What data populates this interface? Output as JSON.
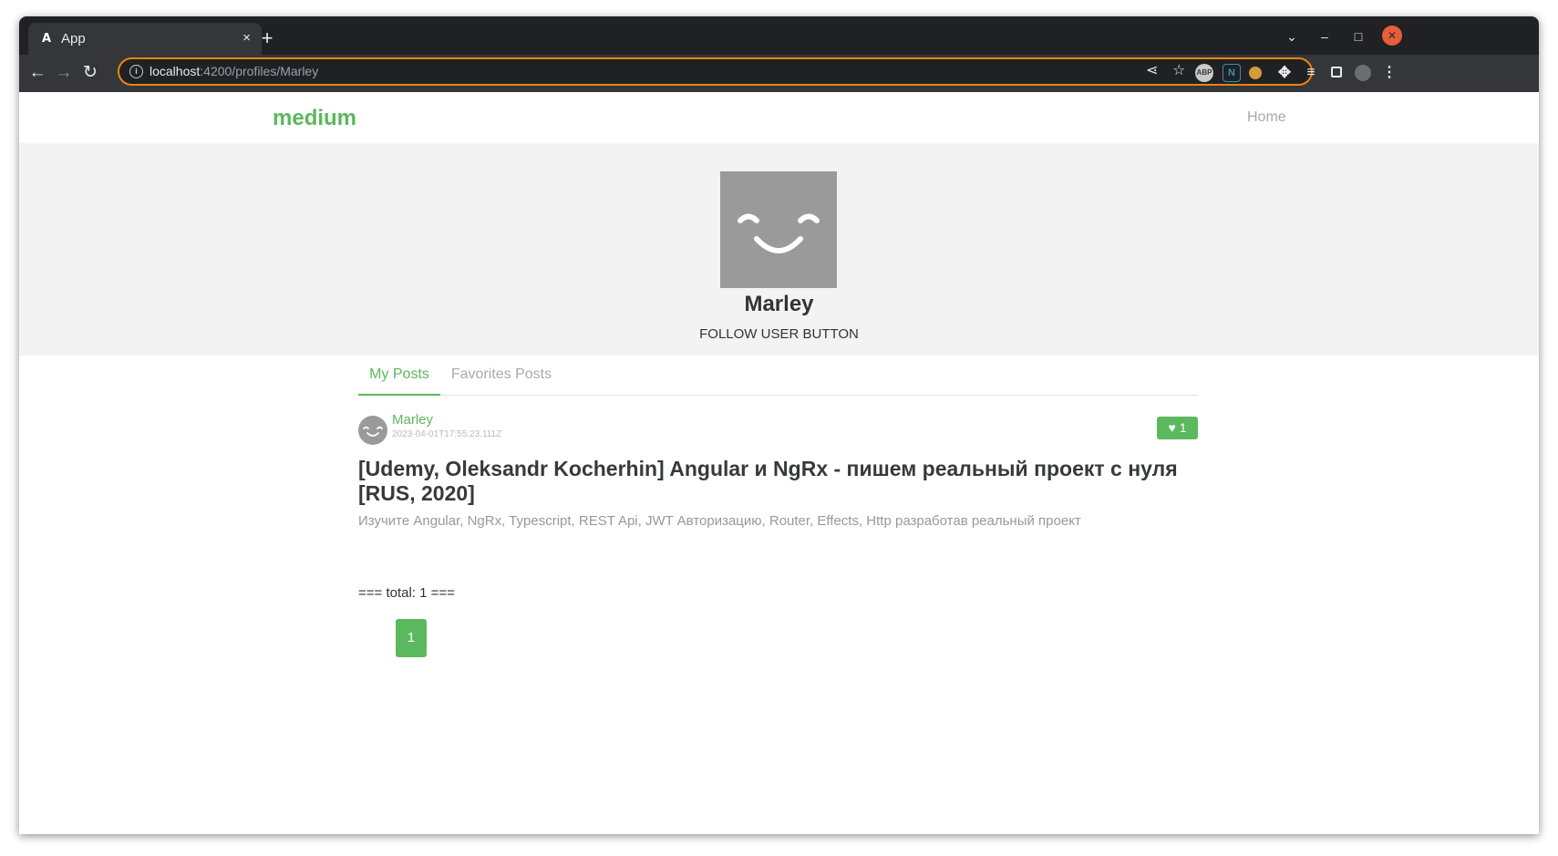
{
  "browser": {
    "tab_title": "App",
    "tab_favicon": "angular-logo",
    "close_tab_glyph": "×",
    "new_tab_glyph": "+",
    "url_host": "localhost",
    "url_path": ":4200/profiles/Marley",
    "icons": [
      "back-arrow-icon",
      "forward-arrow-icon",
      "reload-icon",
      "info-icon",
      "share-icon",
      "star-icon",
      "abp-extension-icon",
      "n-extension-icon",
      "cookie-extension-icon",
      "puzzle-extensions-icon",
      "media-control-icon",
      "side-panel-icon",
      "profile-avatar-icon",
      "kebab-menu-icon",
      "tab-search-chevron-icon",
      "minimize-icon",
      "maximize-icon",
      "close-window-icon"
    ],
    "accent_color": "#e8850e"
  },
  "app": {
    "brand": "medium",
    "nav_home": "Home",
    "brand_color": "#5cb85c"
  },
  "profile": {
    "username": "Marley",
    "follow_button": "FOLLOW USER BUTTON"
  },
  "feed_tabs": [
    {
      "label": "My Posts",
      "active": true
    },
    {
      "label": "Favorites Posts",
      "active": false
    }
  ],
  "articles": [
    {
      "author": "Marley",
      "date": "2023-04-01T17:55:23.111Z",
      "likes": "1",
      "title": "[Udemy, Oleksandr Kocherhin] Angular и NgRx - пишем реальный проект с нуля [RUS, 2020]",
      "description": "Изучите Angular, NgRx, Typescript, REST Api, JWT Авторизацию, Router, Effects, Http разработав реальный проект"
    }
  ],
  "total_text": "=== total: 1 ===",
  "pagination": {
    "pages": [
      "1"
    ],
    "current": "1"
  }
}
